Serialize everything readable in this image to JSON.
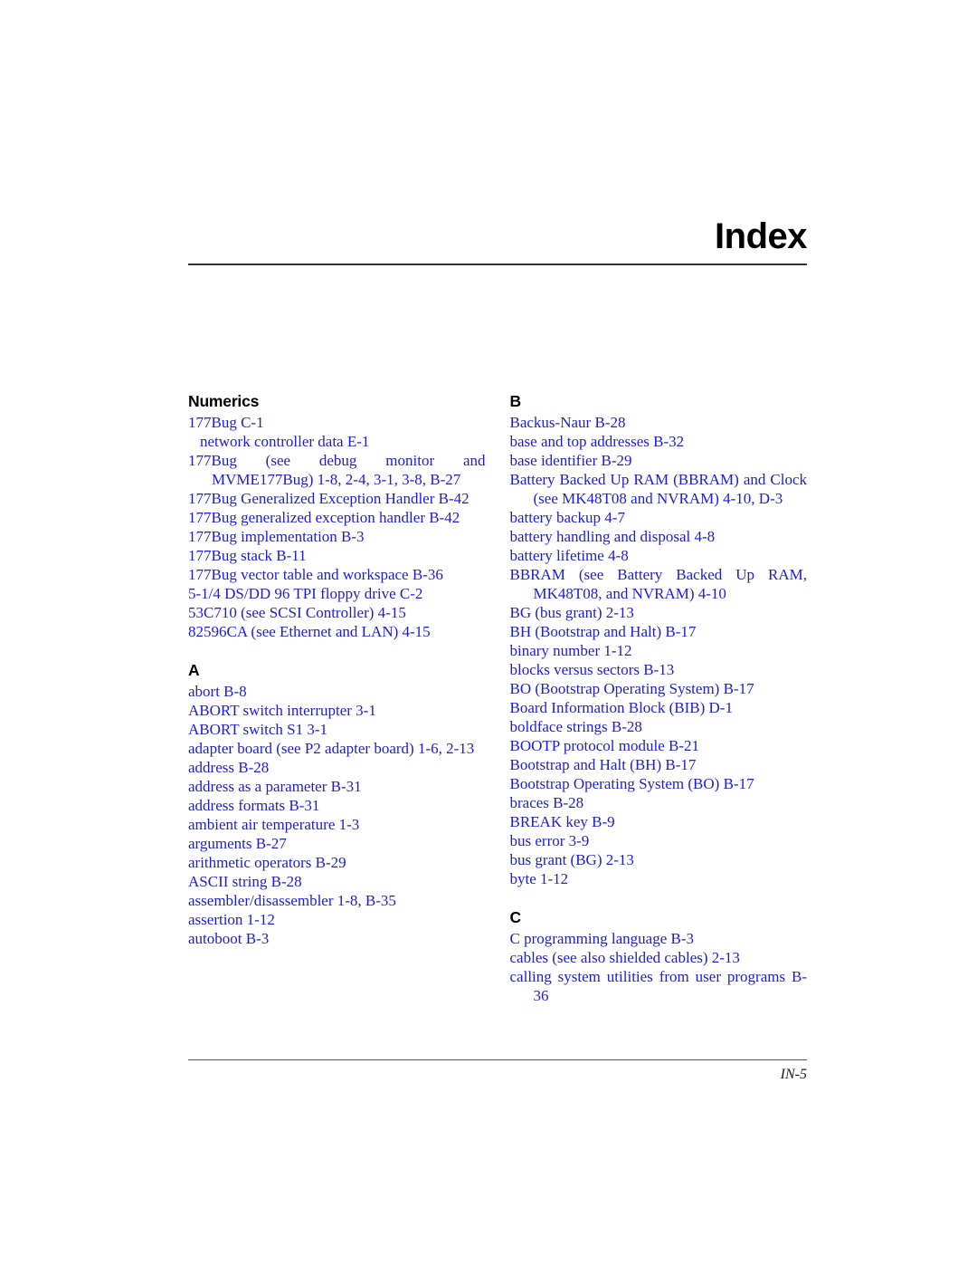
{
  "header": {
    "title": "Index"
  },
  "footer": {
    "page_number": "IN-5"
  },
  "colors": {
    "entry_link": "#1c1ce0",
    "heading": "#000000",
    "rule": "#333333",
    "background": "#ffffff"
  },
  "columns": [
    {
      "name": "left-column",
      "sections": [
        {
          "heading": "Numerics",
          "entries": [
            {
              "text": "177Bug C-1",
              "level": 0,
              "wrapped": false
            },
            {
              "text": "network controller data E-1",
              "level": 1,
              "wrapped": false
            },
            {
              "text": "177Bug (see debug monitor and MVME177Bug) 1-8, 2-4, 3-1, 3-8, B-27",
              "level": 0,
              "wrapped": true
            },
            {
              "text": "177Bug Generalized Exception Handler B-42",
              "level": 0,
              "wrapped": true
            },
            {
              "text": "177Bug generalized exception handler B-42",
              "level": 0,
              "wrapped": true
            },
            {
              "text": "177Bug implementation B-3",
              "level": 0,
              "wrapped": false
            },
            {
              "text": "177Bug stack B-11",
              "level": 0,
              "wrapped": false
            },
            {
              "text": "177Bug vector table and workspace B-36",
              "level": 0,
              "wrapped": false
            },
            {
              "text": "5-1/4 DS/DD 96 TPI floppy drive C-2",
              "level": 0,
              "wrapped": false
            },
            {
              "text": "53C710 (see SCSI Controller) 4-15",
              "level": 0,
              "wrapped": false
            },
            {
              "text": "82596CA (see Ethernet and LAN) 4-15",
              "level": 0,
              "wrapped": false
            }
          ]
        },
        {
          "heading": "A",
          "entries": [
            {
              "text": "abort B-8",
              "level": 0,
              "wrapped": false
            },
            {
              "text": "ABORT switch interrupter 3-1",
              "level": 0,
              "wrapped": false
            },
            {
              "text": "ABORT switch S1 3-1",
              "level": 0,
              "wrapped": false
            },
            {
              "text": "adapter board (see P2 adapter board) 1-6, 2-13",
              "level": 0,
              "wrapped": true
            },
            {
              "text": "address B-28",
              "level": 0,
              "wrapped": false
            },
            {
              "text": "address as a parameter B-31",
              "level": 0,
              "wrapped": false
            },
            {
              "text": "address formats B-31",
              "level": 0,
              "wrapped": false
            },
            {
              "text": "ambient air temperature 1-3",
              "level": 0,
              "wrapped": false
            },
            {
              "text": "arguments B-27",
              "level": 0,
              "wrapped": false
            },
            {
              "text": "arithmetic operators B-29",
              "level": 0,
              "wrapped": false
            },
            {
              "text": "ASCII string B-28",
              "level": 0,
              "wrapped": false
            },
            {
              "text": "assembler/disassembler 1-8, B-35",
              "level": 0,
              "wrapped": false
            },
            {
              "text": "assertion 1-12",
              "level": 0,
              "wrapped": false
            },
            {
              "text": "autoboot B-3",
              "level": 0,
              "wrapped": false
            }
          ]
        }
      ]
    },
    {
      "name": "right-column",
      "sections": [
        {
          "heading": "B",
          "entries": [
            {
              "text": "Backus-Naur B-28",
              "level": 0,
              "wrapped": false
            },
            {
              "text": "base and top addresses B-32",
              "level": 0,
              "wrapped": false
            },
            {
              "text": "base identifier B-29",
              "level": 0,
              "wrapped": false
            },
            {
              "text": "Battery Backed Up RAM (BBRAM) and Clock (see MK48T08 and NVRAM) 4-10, D-3",
              "level": 0,
              "wrapped": true
            },
            {
              "text": "battery backup 4-7",
              "level": 0,
              "wrapped": false
            },
            {
              "text": "battery handling and disposal 4-8",
              "level": 0,
              "wrapped": false
            },
            {
              "text": "battery lifetime 4-8",
              "level": 0,
              "wrapped": false
            },
            {
              "text": "BBRAM (see Battery Backed Up RAM, MK48T08, and NVRAM) 4-10",
              "level": 0,
              "wrapped": true
            },
            {
              "text": "BG (bus grant) 2-13",
              "level": 0,
              "wrapped": false
            },
            {
              "text": "BH (Bootstrap and Halt) B-17",
              "level": 0,
              "wrapped": false
            },
            {
              "text": "binary number 1-12",
              "level": 0,
              "wrapped": false
            },
            {
              "text": "blocks versus sectors B-13",
              "level": 0,
              "wrapped": false
            },
            {
              "text": "BO (Bootstrap Operating System) B-17",
              "level": 0,
              "wrapped": false
            },
            {
              "text": "Board Information Block (BIB) D-1",
              "level": 0,
              "wrapped": false
            },
            {
              "text": "boldface strings B-28",
              "level": 0,
              "wrapped": false
            },
            {
              "text": "BOOTP protocol module B-21",
              "level": 0,
              "wrapped": false
            },
            {
              "text": "Bootstrap and Halt (BH) B-17",
              "level": 0,
              "wrapped": false
            },
            {
              "text": "Bootstrap Operating System (BO) B-17",
              "level": 0,
              "wrapped": false
            },
            {
              "text": "braces B-28",
              "level": 0,
              "wrapped": false
            },
            {
              "text": "BREAK key B-9",
              "level": 0,
              "wrapped": false
            },
            {
              "text": "bus error 3-9",
              "level": 0,
              "wrapped": false
            },
            {
              "text": "bus grant (BG) 2-13",
              "level": 0,
              "wrapped": false
            },
            {
              "text": "byte 1-12",
              "level": 0,
              "wrapped": false
            }
          ]
        },
        {
          "heading": "C",
          "entries": [
            {
              "text": "C programming language B-3",
              "level": 0,
              "wrapped": false
            },
            {
              "text": "cables (see also shielded cables) 2-13",
              "level": 0,
              "wrapped": false
            },
            {
              "text": "calling system utilities from user programs B-36",
              "level": 0,
              "wrapped": true
            }
          ]
        }
      ]
    }
  ]
}
